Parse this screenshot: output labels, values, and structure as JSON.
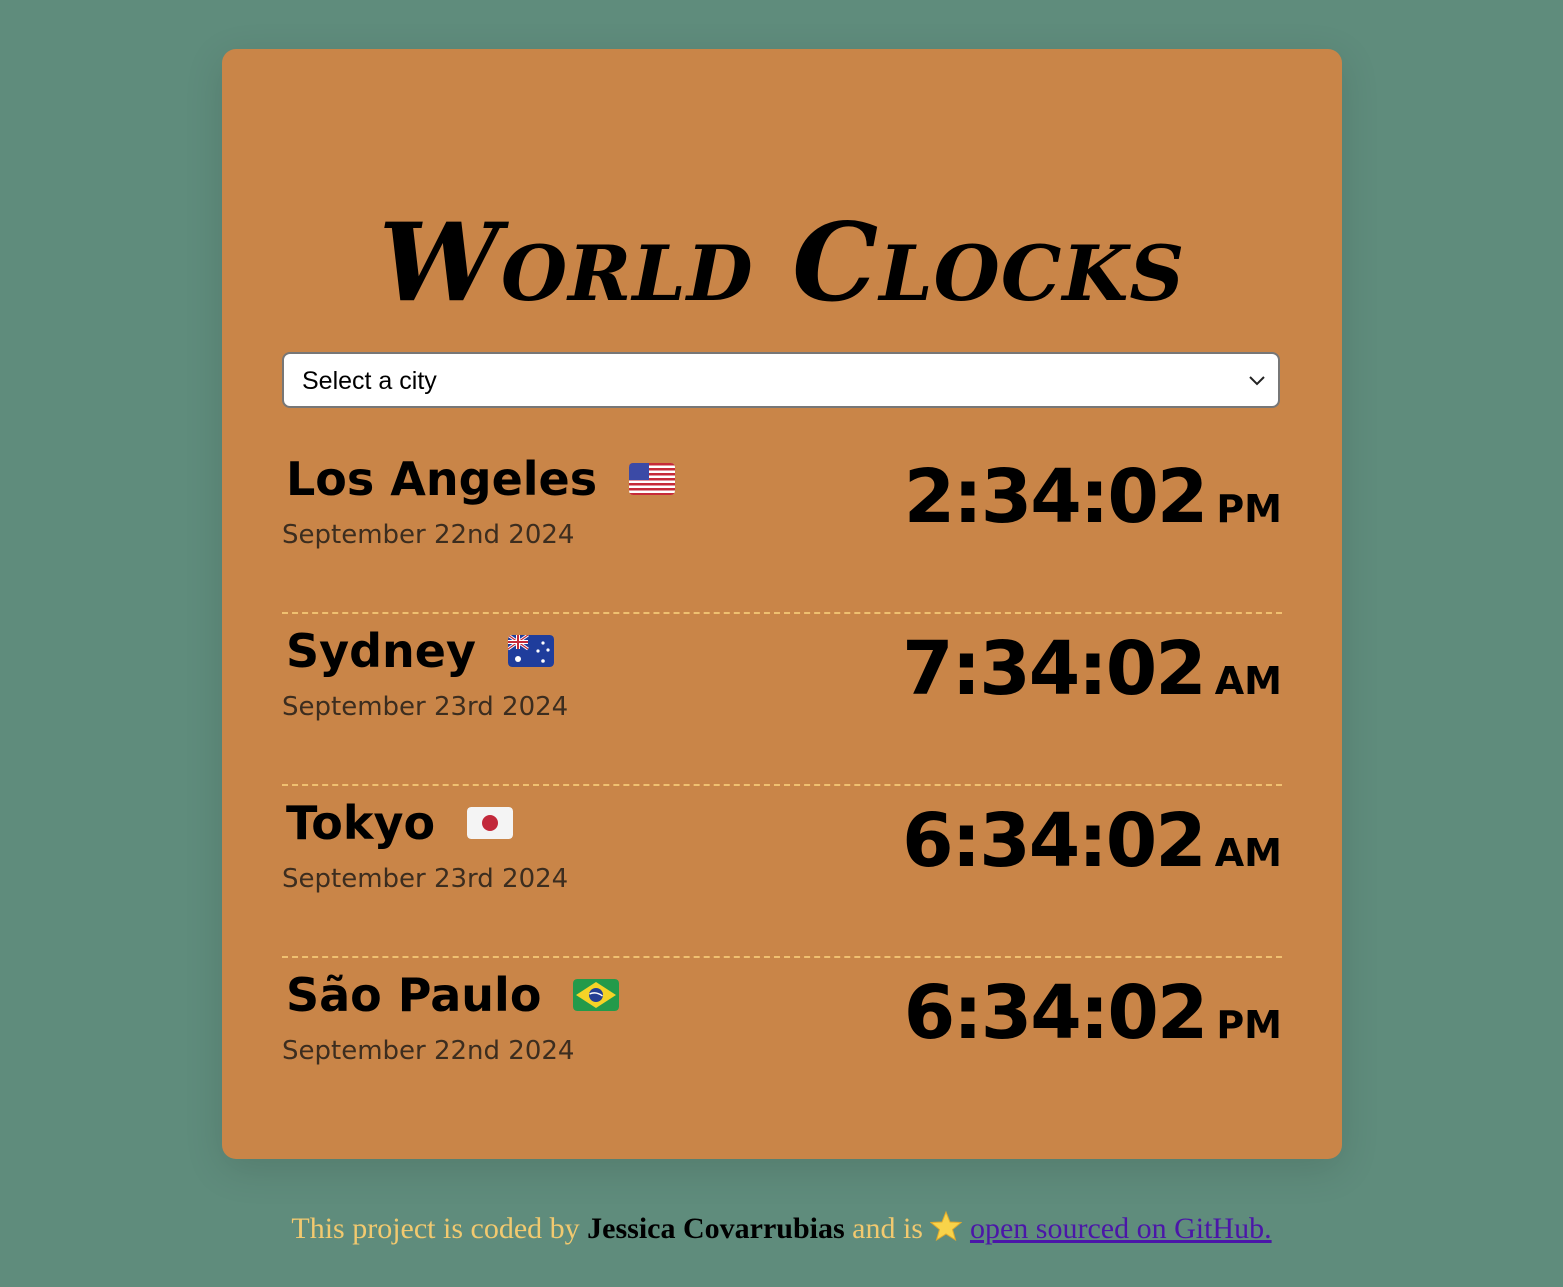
{
  "app": {
    "title": "World Clocks"
  },
  "select": {
    "value": "Select a city"
  },
  "clocks": [
    {
      "city": "Los Angeles",
      "flag": "flag-us-icon",
      "date": "September 22nd 2024",
      "time": "2:34:02",
      "ampm": "PM"
    },
    {
      "city": "Sydney",
      "flag": "flag-au-icon",
      "date": "September 23rd 2024",
      "time": "7:34:02",
      "ampm": "AM"
    },
    {
      "city": "Tokyo",
      "flag": "flag-jp-icon",
      "date": "September 23rd 2024",
      "time": "6:34:02",
      "ampm": "AM"
    },
    {
      "city": "São Paulo",
      "flag": "flag-br-icon",
      "date": "September 22nd 2024",
      "time": "6:34:02",
      "ampm": "PM"
    }
  ],
  "footer": {
    "text_before": "This project is coded by ",
    "author": "Jessica Covarrubias",
    "text_middle": " and is ",
    "star_icon": "star-icon",
    "link_text": "open sourced on GitHub."
  },
  "colors": {
    "background": "#5f8c7c",
    "card": "#c98548",
    "separator": "#f0c070",
    "footer_text": "#f2c96f",
    "link": "#4b16a8"
  }
}
